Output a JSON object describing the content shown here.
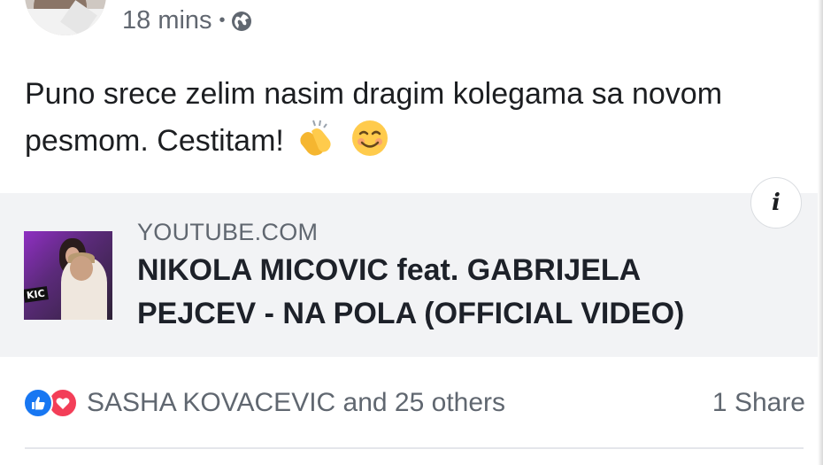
{
  "post": {
    "time": "18 mins",
    "separator": "•",
    "privacy_icon": "globe-icon",
    "text": "Puno srece zelim nasim dragim kolegama sa novom pesmom. Cestitam!",
    "emojis": [
      "clapping-hands-icon",
      "smiling-face-icon"
    ]
  },
  "link": {
    "domain": "YOUTUBE.COM",
    "title": "NIKOLA MICOVIC feat. GABRIJELA PEJCEV - NA POLA (OFFICIAL VIDEO)",
    "info_label": "i",
    "thumbnail_label": "KIC"
  },
  "footer": {
    "reactions_text": "SASHA KOVACEVIC and 25 others",
    "reaction_icons": [
      "like-icon",
      "love-icon"
    ],
    "share_text": "1 Share"
  },
  "colors": {
    "like": "#1877f2",
    "love": "#f33e58",
    "card_bg": "#f2f3f5",
    "meta_text": "#606770"
  }
}
